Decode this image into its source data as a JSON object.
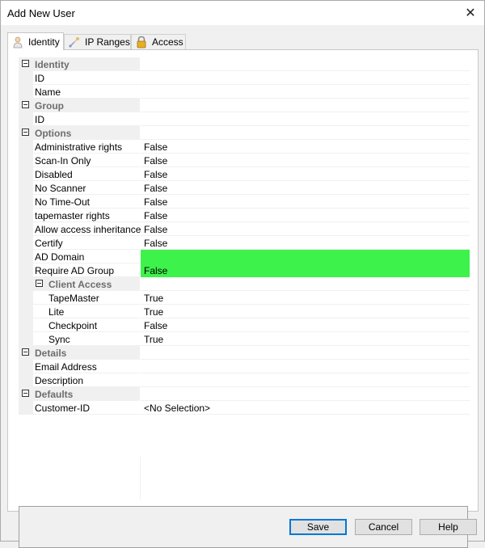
{
  "window": {
    "title": "Add New User",
    "close_glyph": "✕"
  },
  "tabs": [
    {
      "label": "Identity",
      "icon": "user-icon",
      "active": true
    },
    {
      "label": "IP Ranges",
      "icon": "network-icon",
      "active": false
    },
    {
      "label": "Access",
      "icon": "lock-icon",
      "active": false
    }
  ],
  "grid": {
    "rows": [
      {
        "kind": "cat",
        "label": "Identity"
      },
      {
        "kind": "prop",
        "label": "ID",
        "value": ""
      },
      {
        "kind": "prop",
        "label": "Name",
        "value": ""
      },
      {
        "kind": "cat",
        "label": "Group"
      },
      {
        "kind": "prop",
        "label": "ID",
        "value": ""
      },
      {
        "kind": "cat",
        "label": "Options"
      },
      {
        "kind": "prop",
        "label": "Administrative rights",
        "value": "False"
      },
      {
        "kind": "prop",
        "label": "Scan-In Only",
        "value": "False"
      },
      {
        "kind": "prop",
        "label": "Disabled",
        "value": "False"
      },
      {
        "kind": "prop",
        "label": "No Scanner",
        "value": "False"
      },
      {
        "kind": "prop",
        "label": "No Time-Out",
        "value": "False"
      },
      {
        "kind": "prop",
        "label": "tapemaster rights",
        "value": "False"
      },
      {
        "kind": "prop",
        "label": "Allow access inheritance",
        "value": "False"
      },
      {
        "kind": "prop",
        "label": "Certify",
        "value": "False"
      },
      {
        "kind": "prop",
        "label": "AD Domain",
        "value": "",
        "highlight": true
      },
      {
        "kind": "prop",
        "label": "Require AD Group",
        "value": "False",
        "highlight": true
      },
      {
        "kind": "subcat",
        "label": "Client Access"
      },
      {
        "kind": "sub",
        "label": "TapeMaster",
        "value": "True"
      },
      {
        "kind": "sub",
        "label": "Lite",
        "value": "True"
      },
      {
        "kind": "sub",
        "label": "Checkpoint",
        "value": "False"
      },
      {
        "kind": "sub",
        "label": "Sync",
        "value": "True"
      },
      {
        "kind": "cat",
        "label": "Details"
      },
      {
        "kind": "prop",
        "label": "Email Address",
        "value": ""
      },
      {
        "kind": "prop",
        "label": "Description",
        "value": ""
      },
      {
        "kind": "cat",
        "label": "Defaults"
      },
      {
        "kind": "prop",
        "label": "Customer-ID",
        "value": "<No Selection>"
      }
    ]
  },
  "description_panel": {
    "text": ""
  },
  "buttons": {
    "save": "Save",
    "cancel": "Cancel",
    "help": "Help"
  },
  "colors": {
    "highlight": "#3df24b",
    "default_button_border": "#0078d7"
  }
}
